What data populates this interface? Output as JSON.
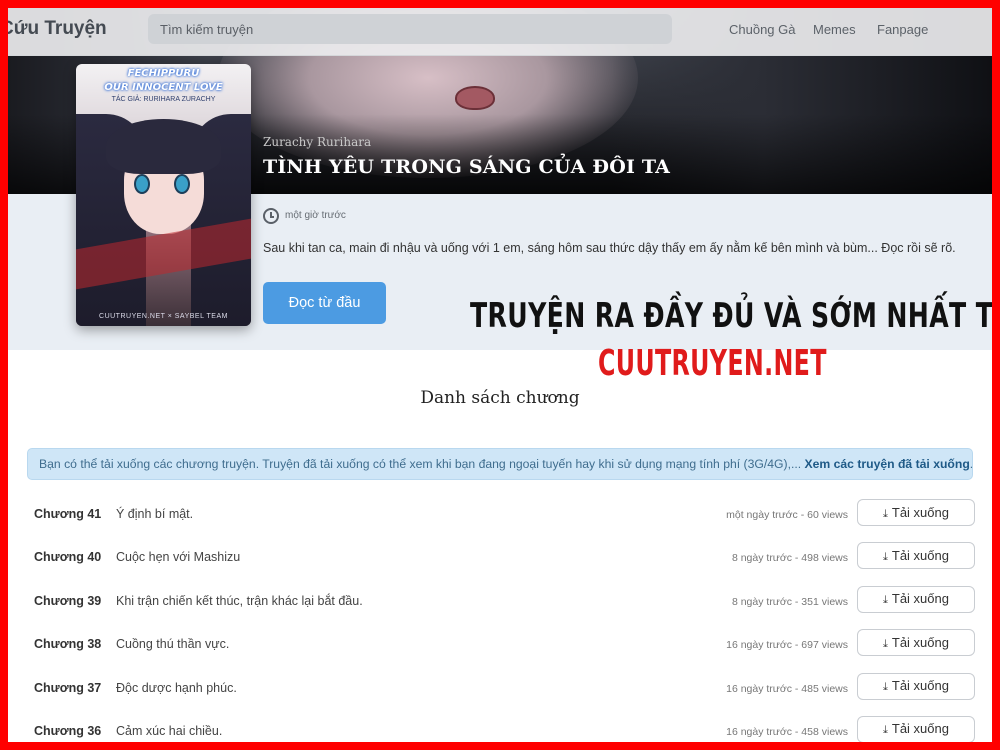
{
  "navbar": {
    "brand": "Cứu Truyện",
    "search_placeholder": "Tìm kiếm truyện",
    "links": [
      "Chuồng Gà",
      "Memes",
      "Fanpage"
    ]
  },
  "manga": {
    "cover_title_line1": "FECHIPPURU",
    "cover_title_line2": "OUR INNOCENT LOVE",
    "cover_author_line": "TÁC GIẢ: RURIHARA ZURACHY",
    "cover_footer": "CUUTRUYEN.NET × SAYBEL TEAM",
    "author": "Zurachy Rurihara",
    "title": "TÌNH YÊU TRONG SÁNG CỦA ĐÔI TA",
    "updated": "một giờ trước",
    "description": "Sau khi tan ca, main đi nhậu và uống với 1 em, sáng hôm sau thức dậy thấy em ấy nằm kế bên mình và bùm... Đọc rồi sẽ rõ.",
    "read_button": "Đọc từ đầu"
  },
  "promo": {
    "line1": "TRUYỆN RA ĐẦY ĐỦ VÀ SỚM NHẤT TẠI:",
    "line2": "CUUTRUYEN.NET",
    "line2_color": "#e01b1b"
  },
  "chapters": {
    "heading": "Danh sách chương",
    "note": "Bạn có thể tải xuống các chương truyện. Truyện đã tải xuống có thể xem khi bạn đang ngoại tuyến hay khi sử dụng mạng tính phí (3G/4G),... ",
    "note_link": "Xem các truyện đã tải xuống",
    "note_end": ".",
    "download_label": "Tải xuống",
    "items": [
      {
        "number": "Chương 41",
        "name": "Ý định bí mật.",
        "meta": "một ngày trước - 60 views"
      },
      {
        "number": "Chương 40",
        "name": "Cuộc hẹn với Mashizu",
        "meta": "8 ngày trước - 498 views"
      },
      {
        "number": "Chương 39",
        "name": "Khi trận chiến kết thúc, trận khác lại bắt đầu.",
        "meta": "8 ngày trước - 351 views"
      },
      {
        "number": "Chương 38",
        "name": "Cuồng thú thần vực.",
        "meta": "16 ngày trước - 697 views"
      },
      {
        "number": "Chương 37",
        "name": "Độc dược hạnh phúc.",
        "meta": "16 ngày trước - 485 views"
      },
      {
        "number": "Chương 36",
        "name": "Cảm xúc hai chiều.",
        "meta": "16 ngày trước - 458 views"
      }
    ]
  },
  "colors": {
    "frame": "#ff0000",
    "accent_button": "#4c9be2",
    "note_background": "#cfe6f7"
  }
}
